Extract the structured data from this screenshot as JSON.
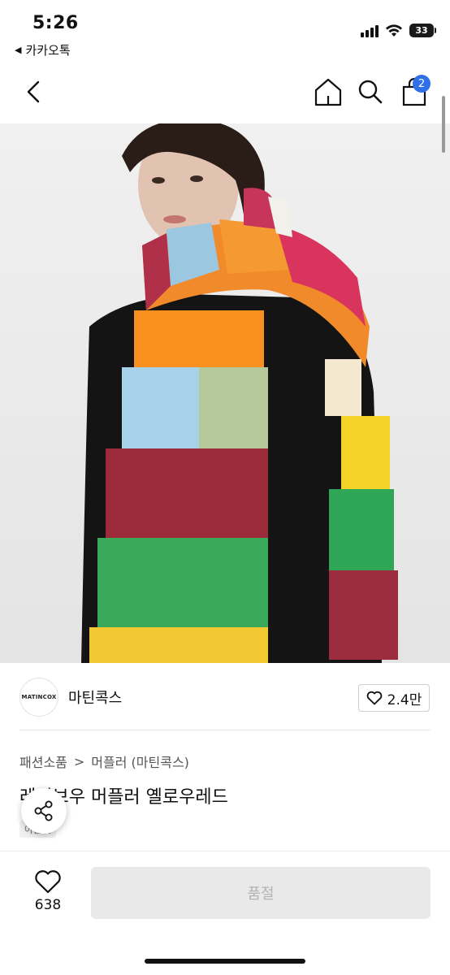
{
  "status": {
    "time": "5:26",
    "back_app": "카카오톡",
    "battery": "33"
  },
  "nav": {
    "cart_count": "2"
  },
  "seller": {
    "logo_text": "MATINCOX",
    "name": "마틴콕스",
    "likes": "2.4만"
  },
  "product": {
    "breadcrumb": [
      "패션소품",
      "머플러 (마틴콕스)"
    ],
    "breadcrumb_sep": ">",
    "title": "레인보우 머플러 옐로우레드",
    "tag": "아울렛"
  },
  "bottom": {
    "wish_count": "638",
    "buy_label": "품절"
  },
  "colors": {
    "badge": "#2f6fe8",
    "buy_bg": "#e9e9e9",
    "buy_text": "#b3b3b3"
  }
}
